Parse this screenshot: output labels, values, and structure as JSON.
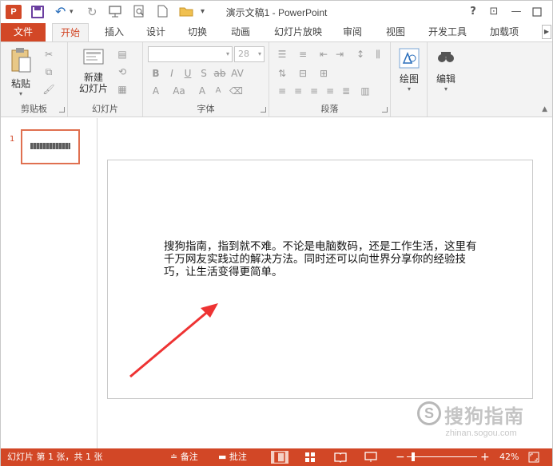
{
  "app": {
    "logo_letter": "P",
    "title": "演示文稿1 - PowerPoint",
    "accent_color": "#d24726"
  },
  "window_controls": {
    "help": "?",
    "ribbon_display": "⊡",
    "minimize": "—",
    "maximize": "☐",
    "close": "✕"
  },
  "quick_access": {
    "undo": "↶",
    "redo": "↻",
    "customize": "▾"
  },
  "tabs": {
    "file": "文件",
    "items": [
      "开始",
      "插入",
      "设计",
      "切换",
      "动画",
      "幻灯片放映",
      "审阅",
      "视图",
      "开发工具",
      "加载项"
    ],
    "active_index": 0
  },
  "ribbon": {
    "clipboard": {
      "paste": "粘贴",
      "label": "剪贴板"
    },
    "slides": {
      "new_slide_line1": "新建",
      "new_slide_line2": "幻灯片",
      "label": "幻灯片"
    },
    "font": {
      "font_size": "28",
      "label": "字体"
    },
    "paragraph": {
      "label": "段落"
    },
    "drawing": {
      "label": "绘图"
    },
    "editing": {
      "label": "编辑"
    }
  },
  "thumbnails": {
    "slide_number": "1"
  },
  "slide": {
    "text": "搜狗指南，指到就不难。不论是电脑数码，还是工作生活，这里有千万网友实践过的解决方法。同时还可以向世界分享你的经验技巧，让生活变得更简单。"
  },
  "statusbar": {
    "slide_info": "幻灯片 第 1 张，共 1 张",
    "notes": "备注",
    "comments": "批注",
    "zoom": "42%",
    "zoom_minus": "−",
    "zoom_plus": "+"
  },
  "watermark": {
    "logo": "S",
    "text": "搜狗指南",
    "url": "zhinan.sogou.com"
  }
}
